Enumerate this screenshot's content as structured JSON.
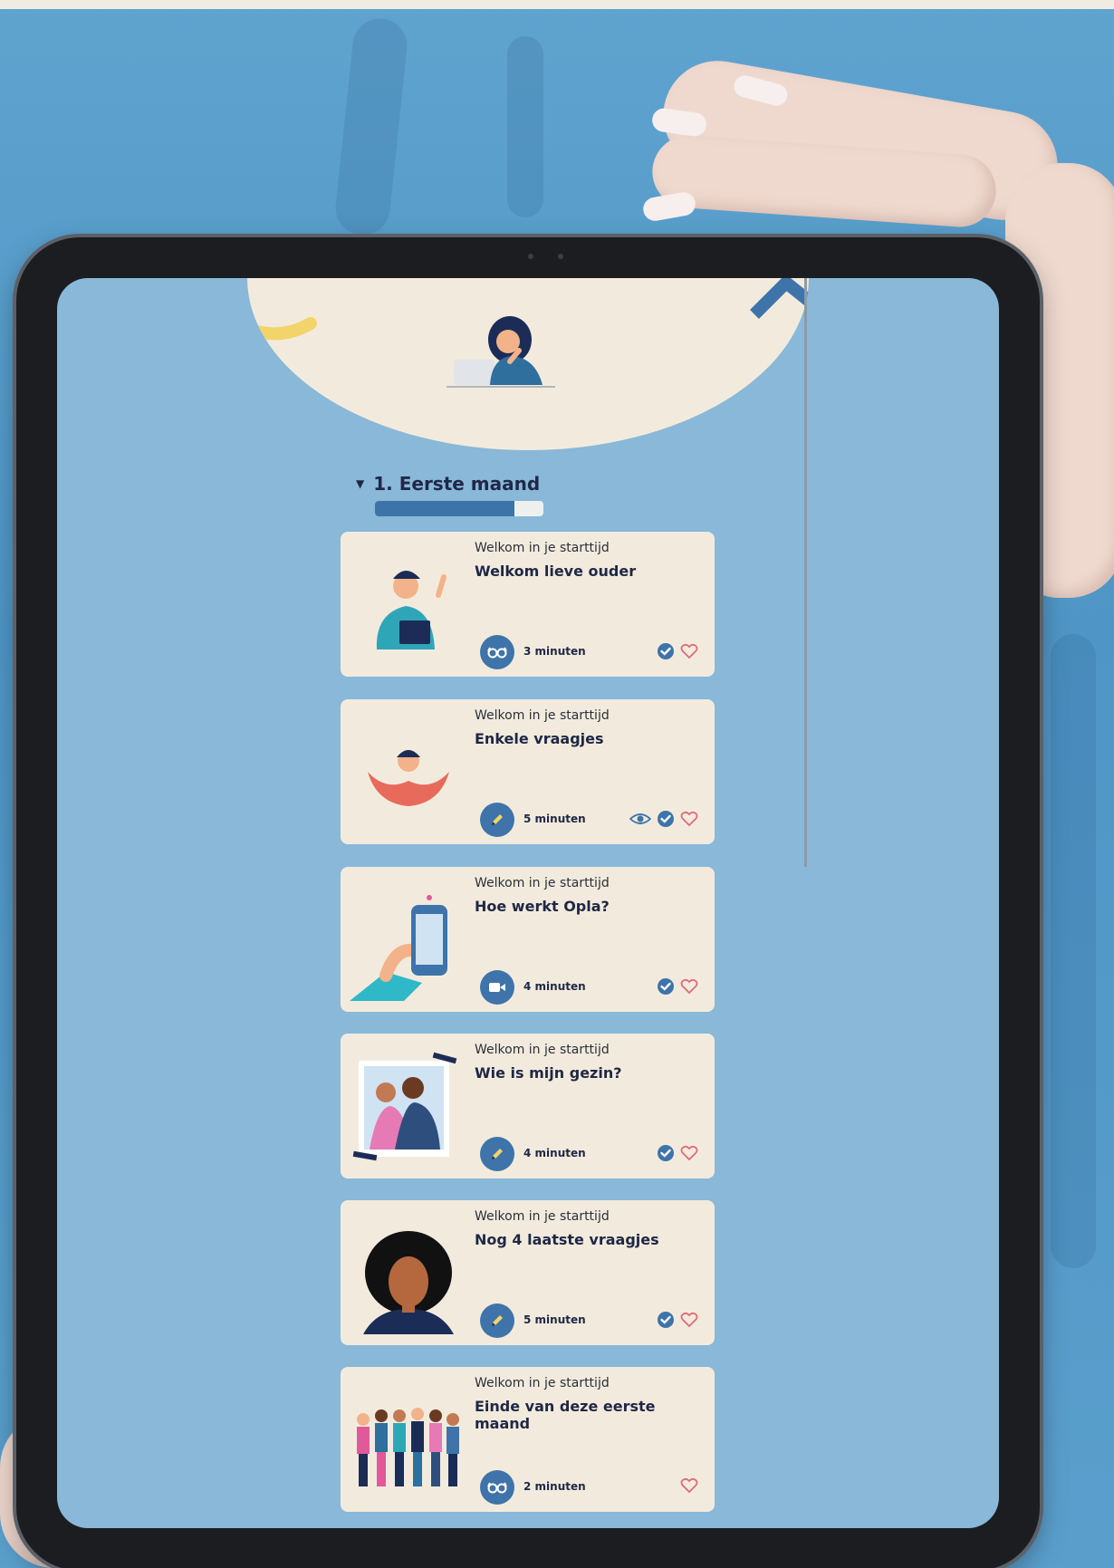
{
  "section": {
    "title": "1. Eerste maand",
    "progress": 0.83
  },
  "cards": [
    {
      "category": "Welkom in je starttijd",
      "title": "Welkom lieve ouder",
      "duration": "3 minuten",
      "mode": "glasses-icon",
      "viewed": false,
      "completed": true
    },
    {
      "category": "Welkom in je starttijd",
      "title": "Enkele vraagjes",
      "duration": "5 minuten",
      "mode": "pencil-icon",
      "viewed": true,
      "completed": true
    },
    {
      "category": "Welkom in je starttijd",
      "title": "Hoe werkt Opla?",
      "duration": "4 minuten",
      "mode": "video-icon",
      "viewed": false,
      "completed": true
    },
    {
      "category": "Welkom in je starttijd",
      "title": "Wie is mijn gezin?",
      "duration": "4 minuten",
      "mode": "pencil-icon",
      "viewed": false,
      "completed": true
    },
    {
      "category": "Welkom in je starttijd",
      "title": "Nog 4 laatste vraagjes",
      "duration": "5 minuten",
      "mode": "pencil-icon",
      "viewed": false,
      "completed": true
    },
    {
      "category": "Welkom in je starttijd",
      "title": "Einde van deze eerste maand",
      "duration": "2 minuten",
      "mode": "glasses-icon",
      "viewed": false,
      "completed": false
    }
  ],
  "colors": {
    "background": "#89b8d8",
    "card": "#f2ebdd",
    "accent": "#3e74aa",
    "heart": "#e06a7a",
    "text": "#1f2745"
  }
}
